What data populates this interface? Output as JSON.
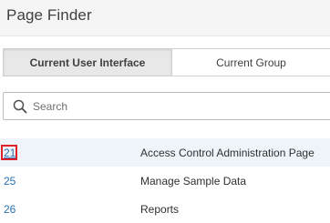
{
  "header": {
    "title": "Page Finder"
  },
  "tabs": [
    {
      "label": "Current User Interface",
      "active": true
    },
    {
      "label": "Current Group",
      "active": false
    }
  ],
  "search": {
    "placeholder": "Search",
    "value": "",
    "icon": "search-icon"
  },
  "rows": [
    {
      "id": "21",
      "name": "Access Control Administration Page",
      "selected": true
    },
    {
      "id": "25",
      "name": "Manage Sample Data",
      "selected": false
    },
    {
      "id": "26",
      "name": "Reports",
      "selected": false
    }
  ],
  "colors": {
    "link": "#2a6fb0",
    "selected_row": "#eef4fa",
    "highlight": "#e0202a",
    "active_tab": "#e8e8e8"
  }
}
